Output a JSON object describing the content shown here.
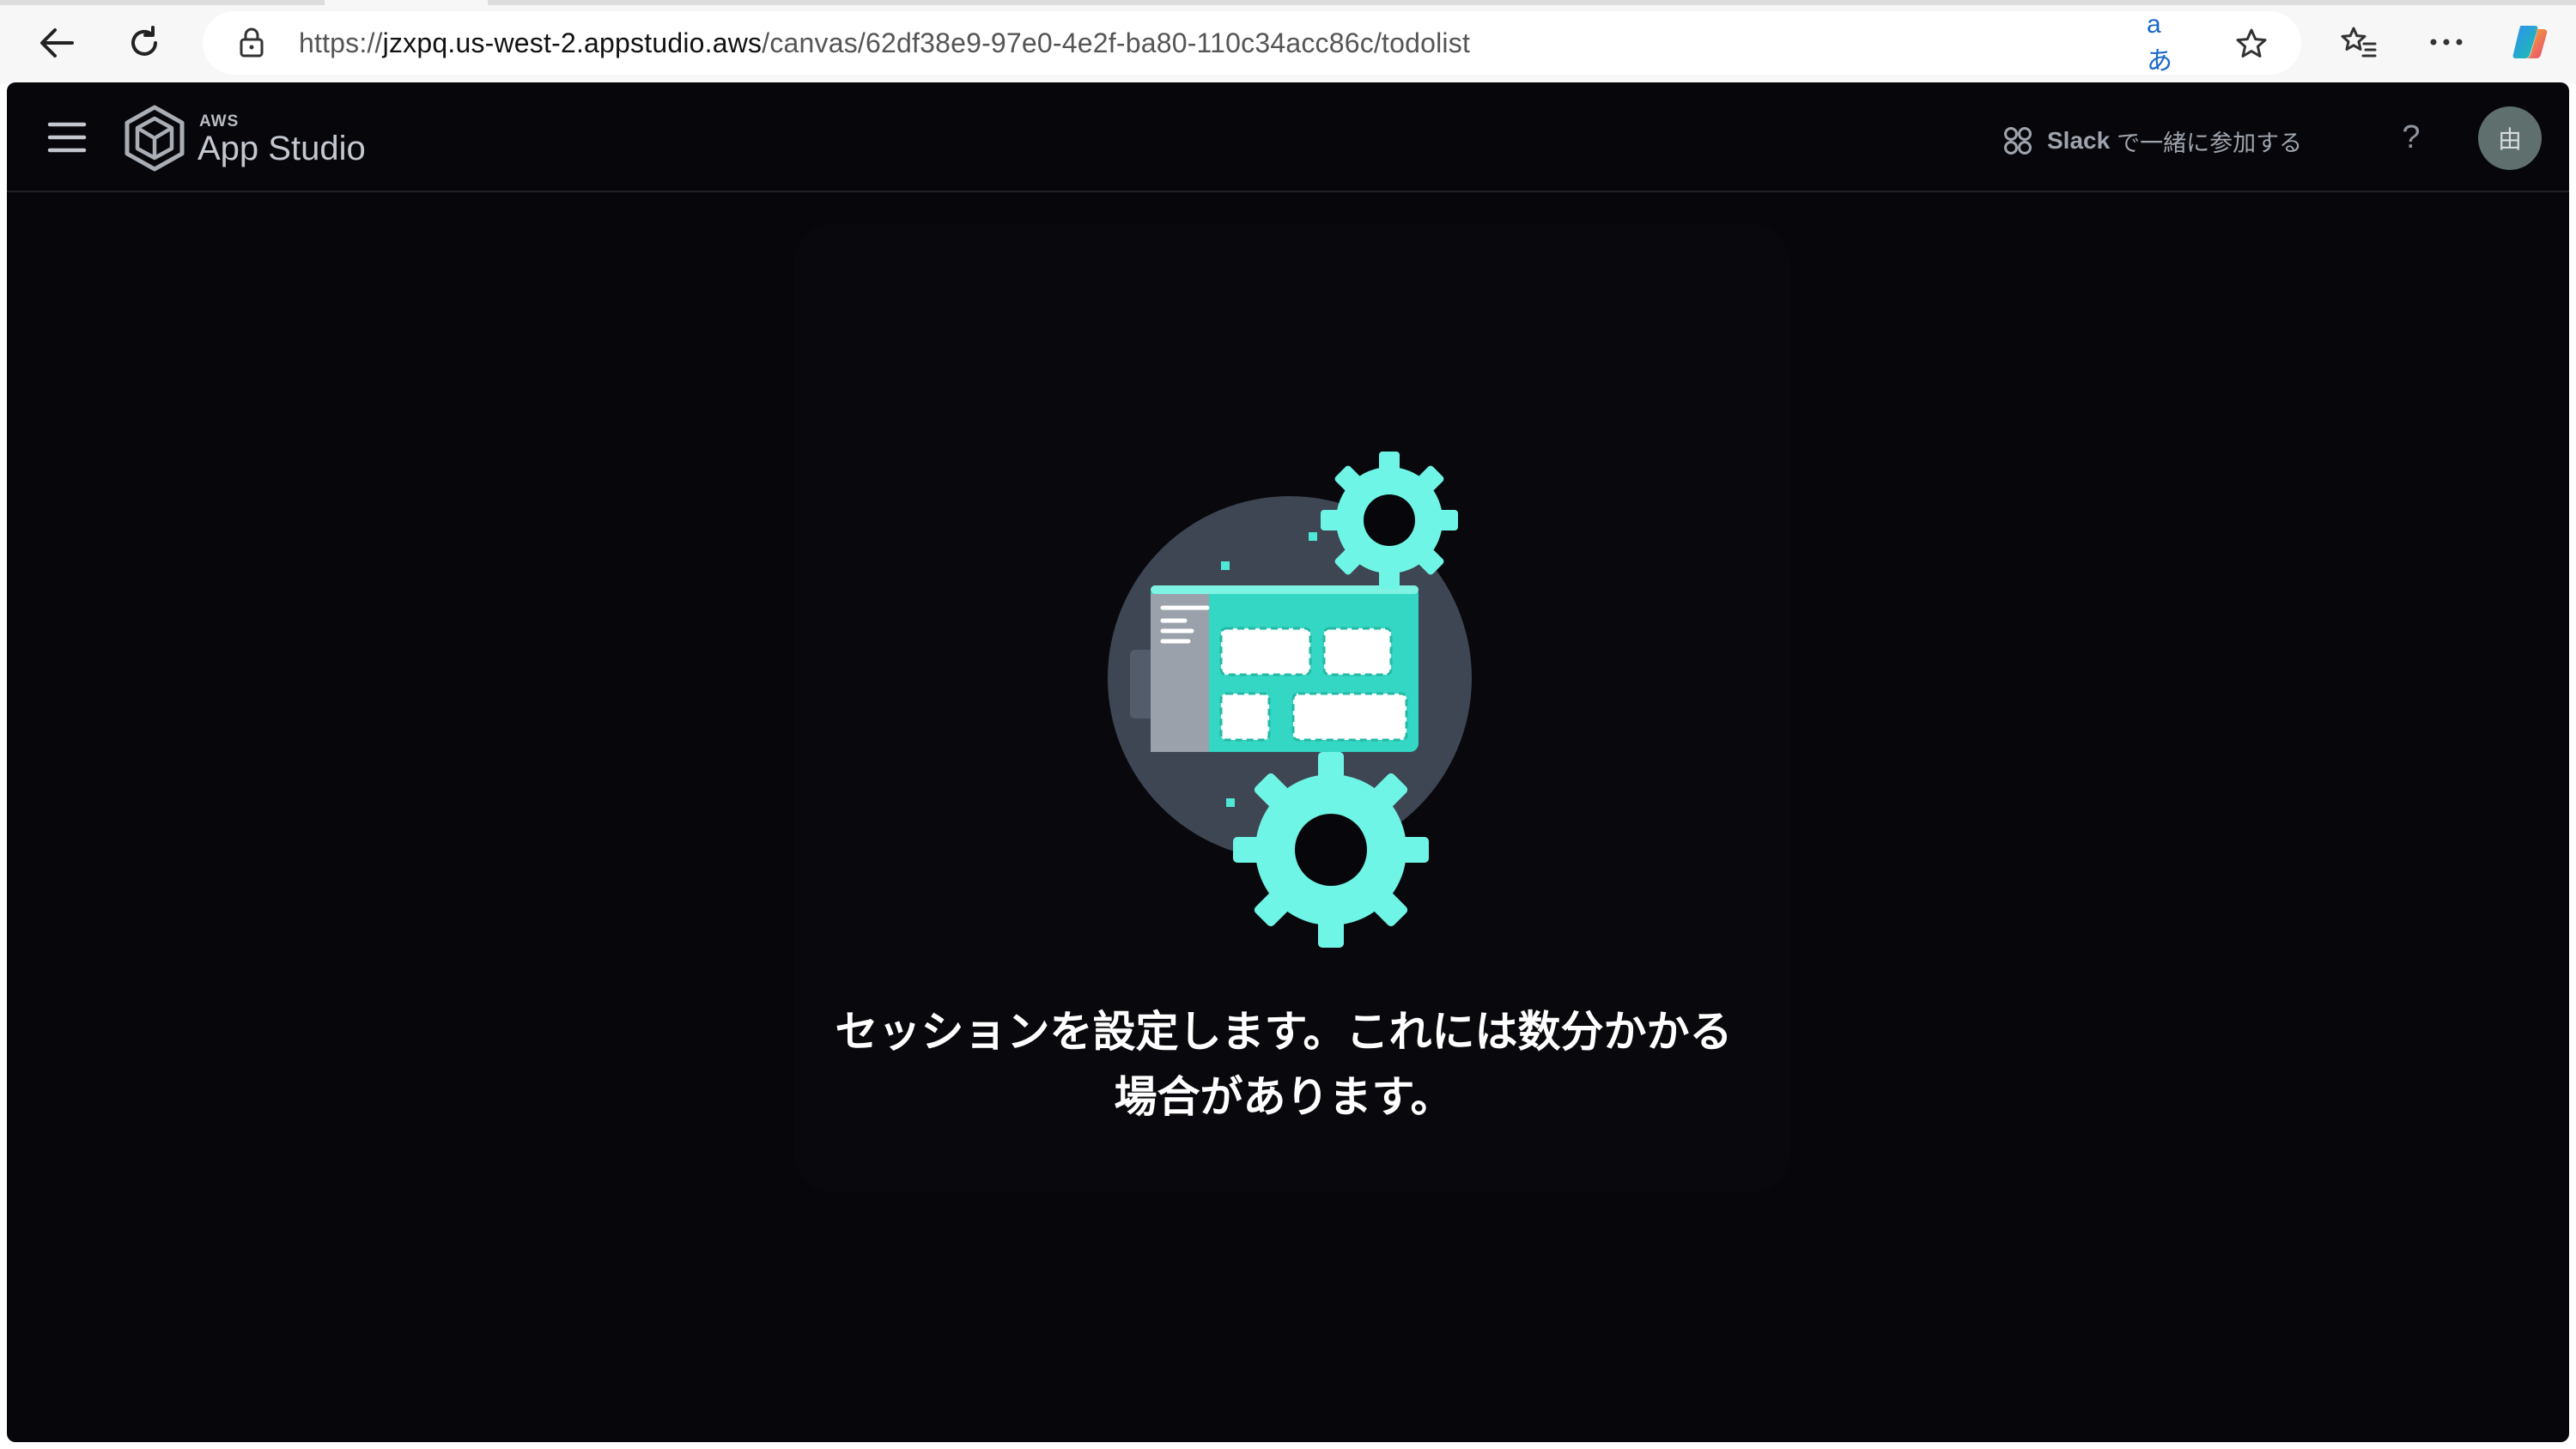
{
  "browser": {
    "url_prefix": "https://",
    "url_domain": "jzxpq.us-west-2.appstudio.aws",
    "url_path": "/canvas/62df38e9-97e0-4e2f-ba80-110c34acc86c/todolist",
    "translate_label": "aあ",
    "icons": {
      "back": "back-arrow-icon",
      "refresh": "refresh-icon",
      "site_info": "site-info-icon",
      "translate": "translate-icon",
      "favorite": "star-icon",
      "favorites_list": "favorites-icon",
      "more": "more-icon",
      "copilot": "copilot-icon"
    }
  },
  "app": {
    "brand_small": "AWS",
    "brand_name": "App Studio",
    "slack_brand": "Slack",
    "slack_rest": "で一緒に参加する",
    "help_label": "?",
    "avatar_initial": "由",
    "colors": {
      "background": "#07070b",
      "accent": "#6ff5e6",
      "avatar": "#5f6f6d"
    }
  },
  "loading": {
    "message_line1": "セッションを設定します。これには数分かかる",
    "message_line2": "場合があります。"
  }
}
